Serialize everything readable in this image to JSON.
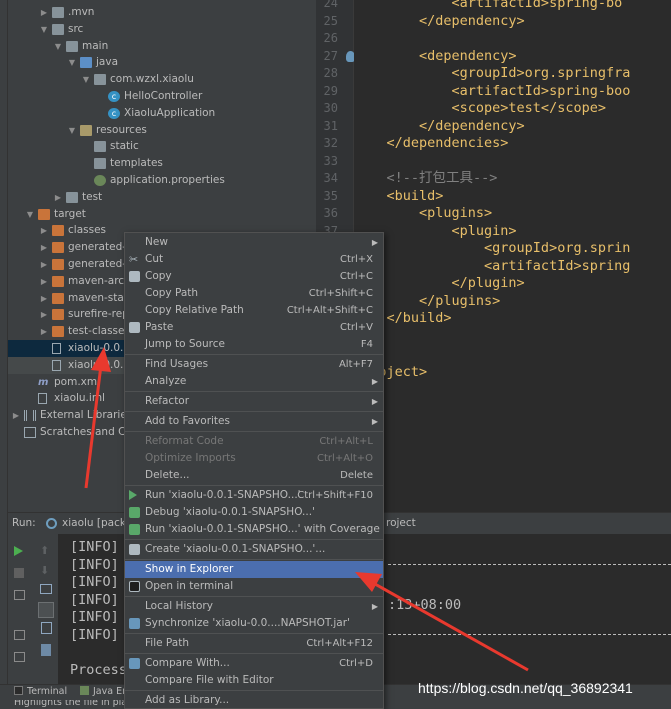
{
  "project_tree": {
    "items": [
      {
        "label": ".mvn",
        "type": "folder",
        "expanded": false
      },
      {
        "label": "src",
        "type": "folder",
        "expanded": true
      },
      {
        "label": "main",
        "type": "folder",
        "expanded": true
      },
      {
        "label": "java",
        "type": "source-folder",
        "expanded": true
      },
      {
        "label": "com.wzxl.xiaolu",
        "type": "package",
        "expanded": true
      },
      {
        "label": "HelloController",
        "type": "class"
      },
      {
        "label": "XiaoluApplication",
        "type": "class"
      },
      {
        "label": "resources",
        "type": "resource-folder",
        "expanded": true
      },
      {
        "label": "static",
        "type": "folder"
      },
      {
        "label": "templates",
        "type": "folder"
      },
      {
        "label": "application.properties",
        "type": "properties"
      },
      {
        "label": "test",
        "type": "folder",
        "expanded": false
      },
      {
        "label": "target",
        "type": "excluded-folder",
        "expanded": true
      },
      {
        "label": "classes",
        "type": "excluded-folder",
        "expanded": false
      },
      {
        "label": "generated-sc",
        "type": "excluded-folder",
        "expanded": false
      },
      {
        "label": "generated-te",
        "type": "excluded-folder",
        "expanded": false
      },
      {
        "label": "maven-archiv",
        "type": "excluded-folder",
        "expanded": false
      },
      {
        "label": "maven-status",
        "type": "excluded-folder",
        "expanded": false
      },
      {
        "label": "surefire-repo",
        "type": "excluded-folder",
        "expanded": false
      },
      {
        "label": "test-classes",
        "type": "excluded-folder",
        "expanded": false
      },
      {
        "label": "xiaolu-0.0.1-S",
        "type": "jar",
        "selected": true
      },
      {
        "label": "xiaolu-0.0.1-S",
        "type": "jar"
      },
      {
        "label": "pom.xml",
        "type": "maven"
      },
      {
        "label": "xiaolu.iml",
        "type": "iml"
      },
      {
        "label": "External Libraries",
        "type": "libraries",
        "expanded": false
      },
      {
        "label": "Scratches and Cons",
        "type": "scratches"
      }
    ]
  },
  "editor": {
    "line_numbers": [
      "24",
      "25",
      "26",
      "27",
      "28",
      "29",
      "30",
      "31",
      "32",
      "33",
      "34",
      "35",
      "36",
      "37",
      "38",
      "39",
      "40",
      "41",
      "42"
    ],
    "lines": [
      "            <artifactId>spring-bo",
      "        </dependency>",
      "",
      "        <dependency>",
      "            <groupId>org.springfra",
      "            <artifactId>spring-boo",
      "            <scope>test</scope>",
      "        </dependency>",
      "    </dependencies>",
      "",
      "    <!--打包工具-->",
      "    <build>",
      "        <plugins>",
      "            <plugin>",
      "                <groupId>org.sprin",
      "                <artifactId>spring",
      "            </plugin>",
      "        </plugins>",
      "    </build>"
    ],
    "footer_line": "/project>"
  },
  "run_panel": {
    "tab_label": "Run:",
    "config_label": "xiaolu [packa",
    "header_right": "roject",
    "console_lines": [
      "[INFO]",
      "[INFO]",
      "[INFO]",
      "[INFO]",
      "[INFO]",
      "[INFO]",
      "",
      "Process"
    ],
    "console_right": [
      ":13+08:00"
    ]
  },
  "bottom_tabs": [
    "Terminal",
    "Java En"
  ],
  "status_text": "Highlights the file in plat",
  "context_menu": {
    "items": [
      {
        "label": "New",
        "shortcut": "",
        "submenu": true,
        "icon": ""
      },
      {
        "label": "Cut",
        "shortcut": "Ctrl+X",
        "icon": "cut-icon"
      },
      {
        "label": "Copy",
        "shortcut": "Ctrl+C",
        "icon": "copy-icon"
      },
      {
        "label": "Copy Path",
        "shortcut": "Ctrl+Shift+C",
        "icon": ""
      },
      {
        "label": "Copy Relative Path",
        "shortcut": "Ctrl+Alt+Shift+C",
        "icon": ""
      },
      {
        "label": "Paste",
        "shortcut": "Ctrl+V",
        "icon": "paste-icon"
      },
      {
        "label": "Jump to Source",
        "shortcut": "F4",
        "icon": ""
      },
      {
        "sep": true
      },
      {
        "label": "Find Usages",
        "shortcut": "Alt+F7",
        "icon": ""
      },
      {
        "label": "Analyze",
        "shortcut": "",
        "submenu": true,
        "icon": ""
      },
      {
        "sep": true
      },
      {
        "label": "Refactor",
        "shortcut": "",
        "submenu": true,
        "icon": ""
      },
      {
        "sep": true
      },
      {
        "label": "Add to Favorites",
        "shortcut": "",
        "submenu": true,
        "icon": ""
      },
      {
        "sep": true
      },
      {
        "label": "Reformat Code",
        "shortcut": "Ctrl+Alt+L",
        "disabled": true,
        "icon": ""
      },
      {
        "label": "Optimize Imports",
        "shortcut": "Ctrl+Alt+O",
        "disabled": true,
        "icon": ""
      },
      {
        "label": "Delete...",
        "shortcut": "Delete",
        "icon": ""
      },
      {
        "sep": true
      },
      {
        "label": "Run 'xiaolu-0.0.1-SNAPSHO...'",
        "shortcut": "Ctrl+Shift+F10",
        "icon": "run-icon"
      },
      {
        "label": "Debug 'xiaolu-0.0.1-SNAPSHO...'",
        "shortcut": "",
        "icon": "debug-icon"
      },
      {
        "label": "Run 'xiaolu-0.0.1-SNAPSHO...' with Coverage",
        "shortcut": "",
        "icon": "coverage-icon"
      },
      {
        "sep": true
      },
      {
        "label": "Create 'xiaolu-0.0.1-SNAPSHO...'...",
        "shortcut": "",
        "icon": "create-config-icon"
      },
      {
        "sep": true
      },
      {
        "label": "Show in Explorer",
        "shortcut": "",
        "active": true,
        "icon": ""
      },
      {
        "label": "Open in terminal",
        "shortcut": "",
        "icon": "terminal-icon"
      },
      {
        "sep": true
      },
      {
        "label": "Local History",
        "shortcut": "",
        "submenu": true,
        "icon": ""
      },
      {
        "label": "Synchronize 'xiaolu-0.0....NAPSHOT.jar'",
        "shortcut": "",
        "icon": "sync-icon"
      },
      {
        "sep": true
      },
      {
        "label": "File Path",
        "shortcut": "Ctrl+Alt+F12",
        "icon": ""
      },
      {
        "sep": true
      },
      {
        "label": "Compare With...",
        "shortcut": "Ctrl+D",
        "icon": "compare-icon"
      },
      {
        "label": "Compare File with Editor",
        "shortcut": "",
        "icon": ""
      },
      {
        "sep": true
      },
      {
        "label": "Add as Library...",
        "shortcut": "",
        "icon": ""
      }
    ]
  },
  "watermark": "https://blog.csdn.net/qq_36892341",
  "colors": {
    "panel": "#3c3f41",
    "editor_bg": "#2b2b2b",
    "menu_highlight": "#4b6eaf",
    "xml_tag": "#e8bf6a",
    "annotation_arrow": "#e8392e"
  }
}
